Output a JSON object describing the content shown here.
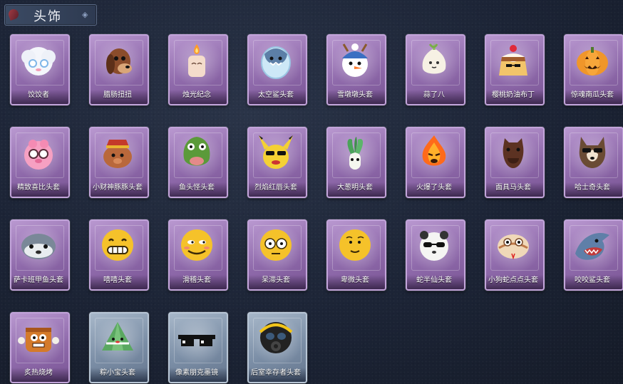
{
  "header": {
    "title": "头饰"
  },
  "items": [
    {
      "label": "饺饺者",
      "theme": "purple",
      "icon": "dumpling-cloud-icon"
    },
    {
      "label": "腊肠扭扭",
      "theme": "purple",
      "icon": "sausage-dog-icon"
    },
    {
      "label": "烛光纪念",
      "theme": "purple",
      "icon": "candle-icon"
    },
    {
      "label": "太空鲨头套",
      "theme": "purple",
      "icon": "space-shark-icon"
    },
    {
      "label": "雪墩墩头套",
      "theme": "purple",
      "icon": "snowman-icon"
    },
    {
      "label": "蒜了八",
      "theme": "purple",
      "icon": "garlic-icon"
    },
    {
      "label": "樱桃奶油布丁",
      "theme": "purple",
      "icon": "pudding-icon"
    },
    {
      "label": "惊魂南瓜头套",
      "theme": "purple",
      "icon": "pumpkin-icon"
    },
    {
      "label": "精致喜比头套",
      "theme": "purple",
      "icon": "pink-pig-icon"
    },
    {
      "label": "小财神豚豚头套",
      "theme": "purple",
      "icon": "wealth-pig-icon"
    },
    {
      "label": "鱼头怪头套",
      "theme": "purple",
      "icon": "fish-head-icon"
    },
    {
      "label": "烈焰红唇头套",
      "theme": "purple",
      "icon": "yellow-pikachu-icon"
    },
    {
      "label": "大葱明头套",
      "theme": "purple",
      "icon": "scallion-icon"
    },
    {
      "label": "火爆了头套",
      "theme": "purple",
      "icon": "fire-icon"
    },
    {
      "label": "面具马头套",
      "theme": "purple",
      "icon": "horse-mask-icon"
    },
    {
      "label": "哈士奇头套",
      "theme": "purple",
      "icon": "husky-icon"
    },
    {
      "label": "萨卡班甲鱼头套",
      "theme": "purple",
      "icon": "sacabambaspis-icon"
    },
    {
      "label": "嘻嘻头套",
      "theme": "purple",
      "icon": "grin-emoji-icon"
    },
    {
      "label": "滑稽头套",
      "theme": "purple",
      "icon": "funny-emoji-icon"
    },
    {
      "label": "呆滞头套",
      "theme": "purple",
      "icon": "dazed-emoji-icon"
    },
    {
      "label": "卑微头套",
      "theme": "purple",
      "icon": "humble-emoji-icon"
    },
    {
      "label": "蛇半仙头套",
      "theme": "purple",
      "icon": "panda-sunglasses-icon"
    },
    {
      "label": "小狗蛇点点头套",
      "theme": "purple",
      "icon": "snake-icon"
    },
    {
      "label": "咬咬鲨头套",
      "theme": "purple",
      "icon": "biting-shark-icon"
    },
    {
      "label": "炙热烧烤",
      "theme": "purple",
      "icon": "bbq-meat-icon"
    },
    {
      "label": "粽小宝头套",
      "theme": "blue",
      "icon": "zongzi-icon"
    },
    {
      "label": "像素朋克墨镜",
      "theme": "blue",
      "icon": "pixel-sunglasses-icon"
    },
    {
      "label": "后室幸存者头套",
      "theme": "blue",
      "icon": "gas-mask-icon"
    }
  ]
}
